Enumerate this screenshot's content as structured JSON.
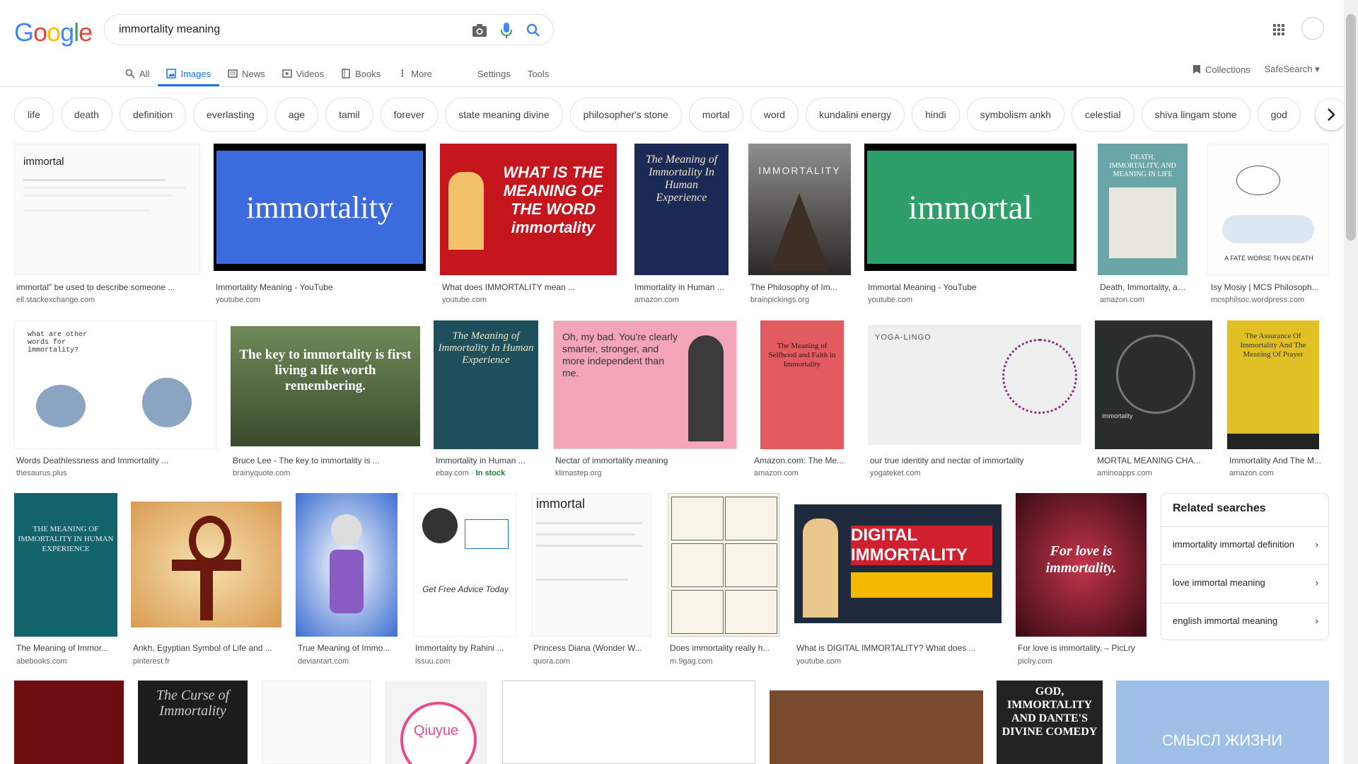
{
  "brand": {
    "logo": "Google"
  },
  "search": {
    "query": "immortality meaning"
  },
  "tabs": [
    {
      "label": "All"
    },
    {
      "label": "Images"
    },
    {
      "label": "News"
    },
    {
      "label": "Videos"
    },
    {
      "label": "Books"
    },
    {
      "label": "More"
    },
    {
      "label": "Settings"
    },
    {
      "label": "Tools"
    }
  ],
  "top_right": {
    "collections": "Collections",
    "safesearch": "SafeSearch"
  },
  "chips": [
    "life",
    "death",
    "definition",
    "everlasting",
    "age",
    "tamil",
    "forever",
    "state meaning divine",
    "philosopher's stone",
    "mortal",
    "word",
    "kundalini energy",
    "hindi",
    "symbolism ankh",
    "celestial",
    "shiva lingam stone",
    "god"
  ],
  "results_row1": [
    {
      "title": "immortal\" be used to describe someone ...",
      "source": "ell.stackexchange.com",
      "thumb_text": "immortal"
    },
    {
      "title": "Immortality Meaning - YouTube",
      "source": "youtube.com",
      "thumb_text": "immortality"
    },
    {
      "title": "What does IMMORTALITY mean ...",
      "source": "youtube.com",
      "thumb_text": "WHAT IS THE MEANING OF THE WORD immortality"
    },
    {
      "title": "Immortality in Human ...",
      "source": "amazon.com",
      "thumb_text": "The Meaning of Immortality In Human Experience"
    },
    {
      "title": "The Philosophy of Im...",
      "source": "brainpickings.org",
      "thumb_text": "IMMORTALITY"
    },
    {
      "title": "Immortal Meaning - YouTube",
      "source": "youtube.com",
      "thumb_text": "immortal"
    },
    {
      "title": "Death, Immortality, an...",
      "source": "amazon.com",
      "thumb_text": "DEATH, IMMORTALITY, AND MEANING IN LIFE"
    },
    {
      "title": "Isy Mosiy | MCS Philosoph...",
      "source": "mcsphilsoc.wordpress.com",
      "thumb_text": "A FATE WORSE THAN DEATH"
    }
  ],
  "results_row2": [
    {
      "title": "Words Deathlessness and Immortality ...",
      "source": "thesaurus.plus",
      "thumb_text": "what are other words for immortality?"
    },
    {
      "title": "Bruce Lee - The key to immortality is ...",
      "source": "brainyquote.com",
      "thumb_text": "The key to immortality is first living a life worth remembering."
    },
    {
      "title": "Immortality in Human ...",
      "source": "ebay.com",
      "badge": "In stock",
      "thumb_text": "The Meaning of Immortality In Human Experience"
    },
    {
      "title": "Nectar of immortality meaning",
      "source": "klimastep.org",
      "thumb_text": "Oh, my bad. You're clearly smarter, stronger, and more independent than me."
    },
    {
      "title": "Amazon.com: The Me...",
      "source": "amazon.com",
      "thumb_text": "The Meaning of Selfhood and Faith in Immortality"
    },
    {
      "title": "our true identity and nectar of immortality",
      "source": "yogateket.com",
      "thumb_text": "YOGA-LINGO"
    },
    {
      "title": "MORTAL MEANING CHA...",
      "source": "aminoapps.com",
      "thumb_text": "immortality"
    },
    {
      "title": "Immortality And The M...",
      "source": "amazon.com",
      "thumb_text": "The Assurance Of Immortality And The Meaning Of Prayer"
    }
  ],
  "results_row3": [
    {
      "title": "The Meaning of Immor...",
      "source": "abebooks.com",
      "thumb_text": "THE MEANING OF IMMORTALITY IN HUMAN EXPERIENCE"
    },
    {
      "title": "Ankh, Egyptian Symbol of Life and ...",
      "source": "pinterest.fr",
      "thumb_text": ""
    },
    {
      "title": "True Meaning of Immo...",
      "source": "deviantart.com",
      "thumb_text": ""
    },
    {
      "title": "Immortality by Rahini ...",
      "source": "issuu.com",
      "thumb_text": "Get Free Advice Today"
    },
    {
      "title": "Princess Diana (Wonder W...",
      "source": "quora.com",
      "thumb_text": "immortal"
    },
    {
      "title": "Does immortality really h...",
      "source": "m.9gag.com",
      "thumb_text": ""
    },
    {
      "title": "What is DIGITAL IMMORTALITY? What does ...",
      "source": "youtube.com",
      "thumb_text": "DIGITAL IMMORTALITY"
    },
    {
      "title": "For love is immortality. – PicLry",
      "source": "piclry.com",
      "thumb_text": "For love is immortality."
    }
  ],
  "related": {
    "heading": "Related searches",
    "items": [
      "immortality immortal definition",
      "love immortal meaning",
      "english immortal meaning"
    ]
  },
  "row4_texts": [
    "The Curse of Immortality",
    "Qiuyue",
    "GOD, IMMORTALITY AND DANTE'S DIVINE COMEDY",
    "СМЫСЛ ЖИЗНИ"
  ]
}
